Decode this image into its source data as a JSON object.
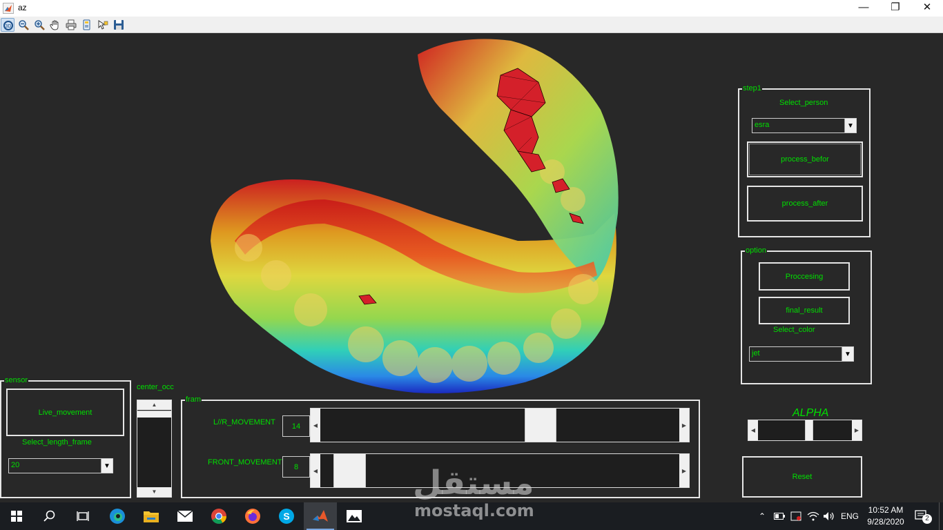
{
  "window": {
    "title": "az"
  },
  "toolbar": {
    "buttons": [
      "rotate-3d",
      "zoom-out",
      "zoom-in",
      "pan",
      "print",
      "data-cursor",
      "edit-plot",
      "save"
    ]
  },
  "figure": {
    "panels": {
      "step1": {
        "title": "step1",
        "select_person_label": "Select_person",
        "person_value": "esra",
        "process_before_label": "process_befor",
        "process_after_label": "process_after"
      },
      "option": {
        "title": "option",
        "processing_label": "Proccesing",
        "final_result_label": "final_result",
        "select_color_label": "Select_color",
        "color_value": "jet"
      },
      "sensor": {
        "title": "sensor",
        "live_movement_label": "Live_movement",
        "select_length_frame_label": "Select_length_frame",
        "length_frame_value": "20"
      },
      "center_occ": {
        "label": "center_occ"
      },
      "fram": {
        "title": "fram",
        "lr_label": "L//R_MOVEMENT",
        "lr_value": "14",
        "lr_position": 0.625,
        "front_label": "FRONT_MOVEMENT",
        "front_value": "8",
        "front_position": 0.04
      },
      "alpha": {
        "label": "ALPHA",
        "position": 0.55
      },
      "reset_label": "Reset"
    }
  },
  "watermark": {
    "logo": "مستقل",
    "text": "mostaql.com"
  },
  "taskbar": {
    "apps": [
      "windows-start",
      "search",
      "task-view",
      "edge",
      "file-explorer",
      "mail",
      "chrome",
      "firefox",
      "skype",
      "matlab",
      "photos"
    ],
    "language": "ENG",
    "time": "10:52 AM",
    "date": "9/28/2020",
    "notifications_count": "2"
  },
  "colors": {
    "label_green": "#00e000",
    "background": "#282828",
    "taskbar": "#1a1d21"
  }
}
